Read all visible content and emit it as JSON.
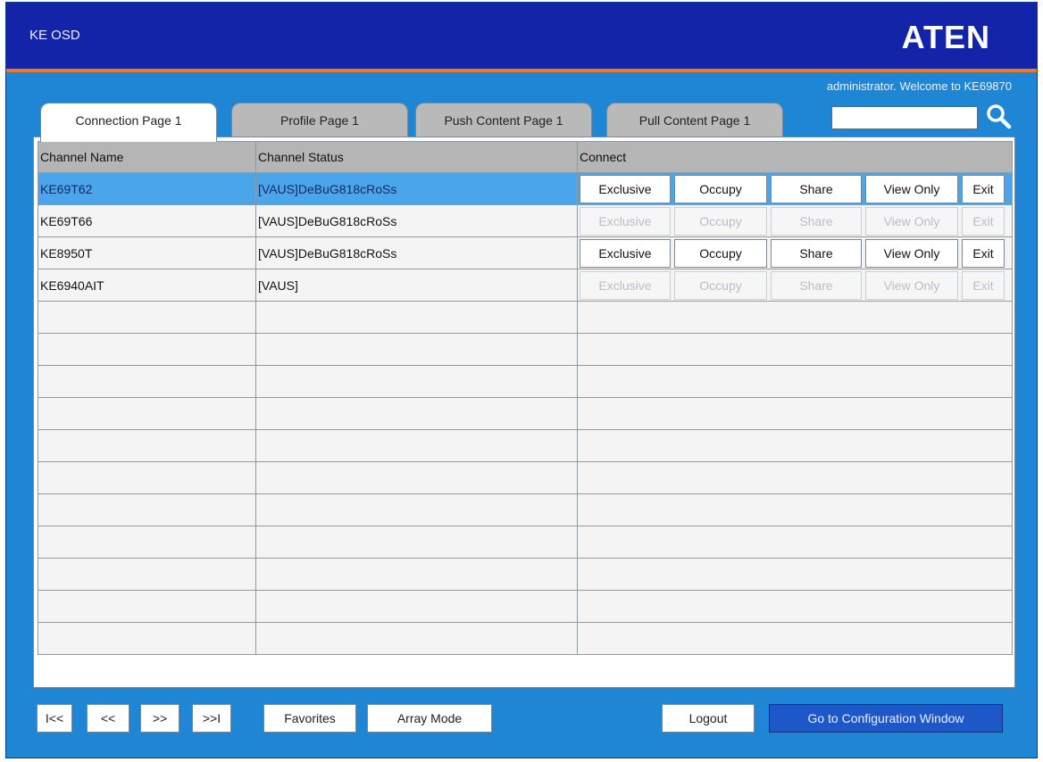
{
  "window": {
    "title": "KE OSD",
    "brand": "ATEN"
  },
  "header": {
    "welcome": "administrator. Welcome to KE69870"
  },
  "tabs": [
    {
      "label": "Connection Page 1",
      "active": true
    },
    {
      "label": "Profile Page 1",
      "active": false
    },
    {
      "label": "Push Content Page 1",
      "active": false
    },
    {
      "label": "Pull Content Page 1",
      "active": false
    }
  ],
  "search": {
    "value": "",
    "placeholder": ""
  },
  "table": {
    "headers": [
      "Channel Name",
      "Channel Status",
      "Connect"
    ],
    "rows": [
      {
        "name": "KE69T62",
        "status": "[VAUS]DeBuG818cRoSs",
        "buttons_enabled": true,
        "selected": true
      },
      {
        "name": "KE69T66",
        "status": "[VAUS]DeBuG818cRoSs",
        "buttons_enabled": false,
        "selected": false
      },
      {
        "name": "KE8950T",
        "status": "[VAUS]DeBuG818cRoSs",
        "buttons_enabled": true,
        "selected": false
      },
      {
        "name": "KE6940AIT",
        "status": "[VAUS]",
        "buttons_enabled": false,
        "selected": false
      }
    ],
    "connect_buttons": [
      "Exclusive",
      "Occupy",
      "Share",
      "View Only",
      "Exit"
    ]
  },
  "nav": {
    "first": "I<<",
    "prev": "<<",
    "next": ">>",
    "last": ">>I"
  },
  "footer": {
    "favorites": "Favorites",
    "array_mode": "Array Mode",
    "logout": "Logout",
    "config": "Go to Configuration Window"
  },
  "colors": {
    "titlebar": "#1424a8",
    "accent_line": "#f07a1e",
    "body": "#1f86d6",
    "selected_row": "#4aa5ea",
    "config_button": "#1e58c8"
  }
}
